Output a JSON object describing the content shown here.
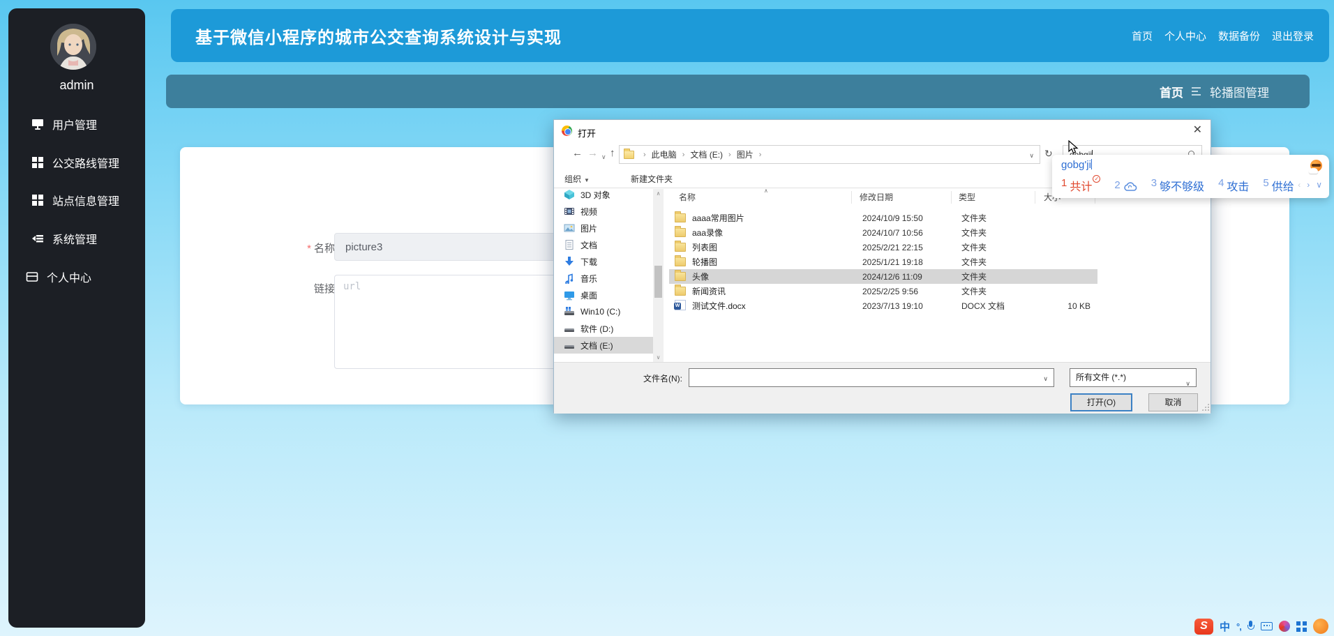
{
  "colors": {
    "header_blue": "#1d9ad8",
    "breadcrumb_teal": "#3d7f9c",
    "sidebar_dark": "#1c1f25",
    "ime_blue": "#2d6ed3",
    "ime_red": "#e0482e",
    "folder_yellow": "#eecb6d"
  },
  "page": {
    "title": "基于微信小程序的城市公交查询系统设计与实现",
    "nav_links": [
      {
        "label": "首页"
      },
      {
        "label": "个人中心"
      },
      {
        "label": "数据备份"
      },
      {
        "label": "退出登录"
      }
    ],
    "breadcrumb": {
      "home": "首页",
      "current": "轮播图管理"
    }
  },
  "sidebar": {
    "username": "admin",
    "items": [
      {
        "label": "用户管理",
        "icon": "monitor-icon"
      },
      {
        "label": "公交路线管理",
        "icon": "grid-icon"
      },
      {
        "label": "站点信息管理",
        "icon": "grid-icon"
      },
      {
        "label": "系统管理",
        "icon": "list-icon"
      },
      {
        "label": "个人中心",
        "icon": "profile-icon"
      }
    ]
  },
  "form": {
    "required_mark": "*",
    "name_label": "名称",
    "name_value": "picture3",
    "link_label": "链接",
    "link_placeholder": "url"
  },
  "dialog": {
    "title": "打开",
    "address": [
      {
        "label": "此电脑"
      },
      {
        "label": "文档 (E:)"
      },
      {
        "label": "图片"
      }
    ],
    "search_value": "gobgji",
    "toolbar": {
      "organize": "组织",
      "new_folder": "新建文件夹"
    },
    "sidebar_items": [
      {
        "label": "3D 对象"
      },
      {
        "label": "视频"
      },
      {
        "label": "图片"
      },
      {
        "label": "文档"
      },
      {
        "label": "下载"
      },
      {
        "label": "音乐"
      },
      {
        "label": "桌面"
      },
      {
        "label": "Win10 (C:)"
      },
      {
        "label": "软件 (D:)"
      },
      {
        "label": "文档 (E:)"
      }
    ],
    "columns": [
      {
        "label": "名称"
      },
      {
        "label": "修改日期"
      },
      {
        "label": "类型"
      },
      {
        "label": "大小"
      }
    ],
    "files": [
      {
        "name": "aaaa常用图片",
        "date": "2024/10/9 15:50",
        "type": "文件夹",
        "size": ""
      },
      {
        "name": "aaa录像",
        "date": "2024/10/7 10:56",
        "type": "文件夹",
        "size": ""
      },
      {
        "name": "列表图",
        "date": "2025/2/21 22:15",
        "type": "文件夹",
        "size": ""
      },
      {
        "name": "轮播图",
        "date": "2025/1/21 19:18",
        "type": "文件夹",
        "size": ""
      },
      {
        "name": "头像",
        "date": "2024/12/6 11:09",
        "type": "文件夹",
        "size": ""
      },
      {
        "name": "新闻资讯",
        "date": "2025/2/25 9:56",
        "type": "文件夹",
        "size": ""
      },
      {
        "name": "测试文件.docx",
        "date": "2023/7/13 19:10",
        "type": "DOCX 文档",
        "size": "10 KB"
      }
    ],
    "filename_label": "文件名(N):",
    "filename_value": "",
    "filetype_value": "所有文件 (*.*)",
    "open_button": "打开(O)",
    "cancel_button": "取消"
  },
  "ime": {
    "composition": "gobg'ji",
    "candidates": [
      {
        "num": "1",
        "text": "共计"
      },
      {
        "num": "2",
        "text": ""
      },
      {
        "num": "3",
        "text": "够不够级"
      },
      {
        "num": "4",
        "text": "攻击"
      },
      {
        "num": "5",
        "text": "供给"
      }
    ]
  }
}
